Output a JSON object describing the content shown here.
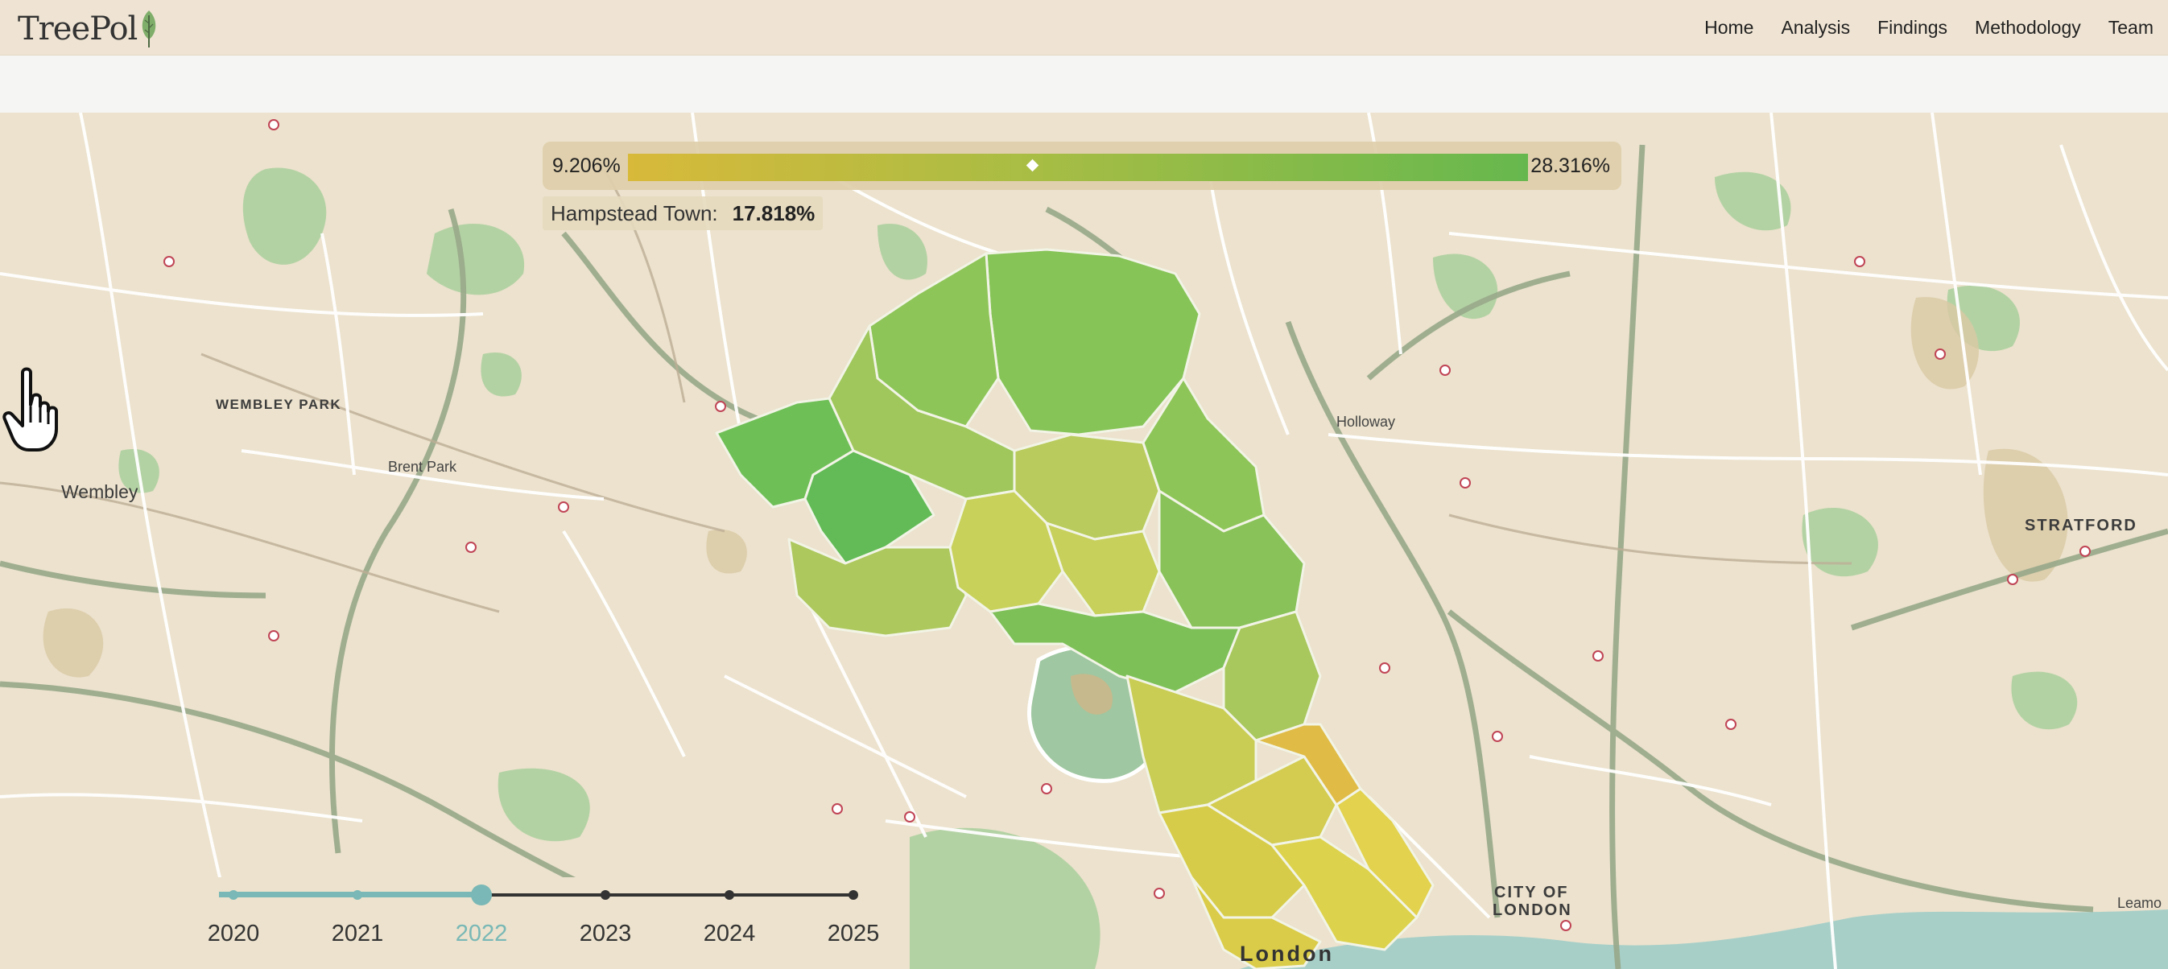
{
  "app": {
    "logo_text": "TreePol"
  },
  "nav": {
    "items": [
      "Home",
      "Analysis",
      "Findings",
      "Methodology",
      "Team"
    ]
  },
  "legend": {
    "min_label": "9.206%",
    "max_label": "28.316%",
    "marker_fraction": 0.45
  },
  "tooltip": {
    "area_label": "Hampstead Town:",
    "value": "17.818%"
  },
  "map_labels": {
    "wembley_park": "WEMBLEY PARK",
    "wembley": "Wembley",
    "brent_park": "Brent Park",
    "holloway": "Holloway",
    "stratford": "STRATFORD",
    "city_of_london_1": "CITY OF",
    "city_of_london_2": "LONDON",
    "london": "London",
    "leamouth": "Leamo"
  },
  "timeline": {
    "years": [
      "2020",
      "2021",
      "2022",
      "2023",
      "2024",
      "2025"
    ],
    "selected": "2022",
    "active_color": "#79b8b6",
    "inactive_color": "#333333"
  },
  "colors": {
    "scale_low": "#d8b93a",
    "scale_mid": "#a8bd44",
    "scale_high": "#66b84e",
    "map_background": "#ece2cd"
  }
}
